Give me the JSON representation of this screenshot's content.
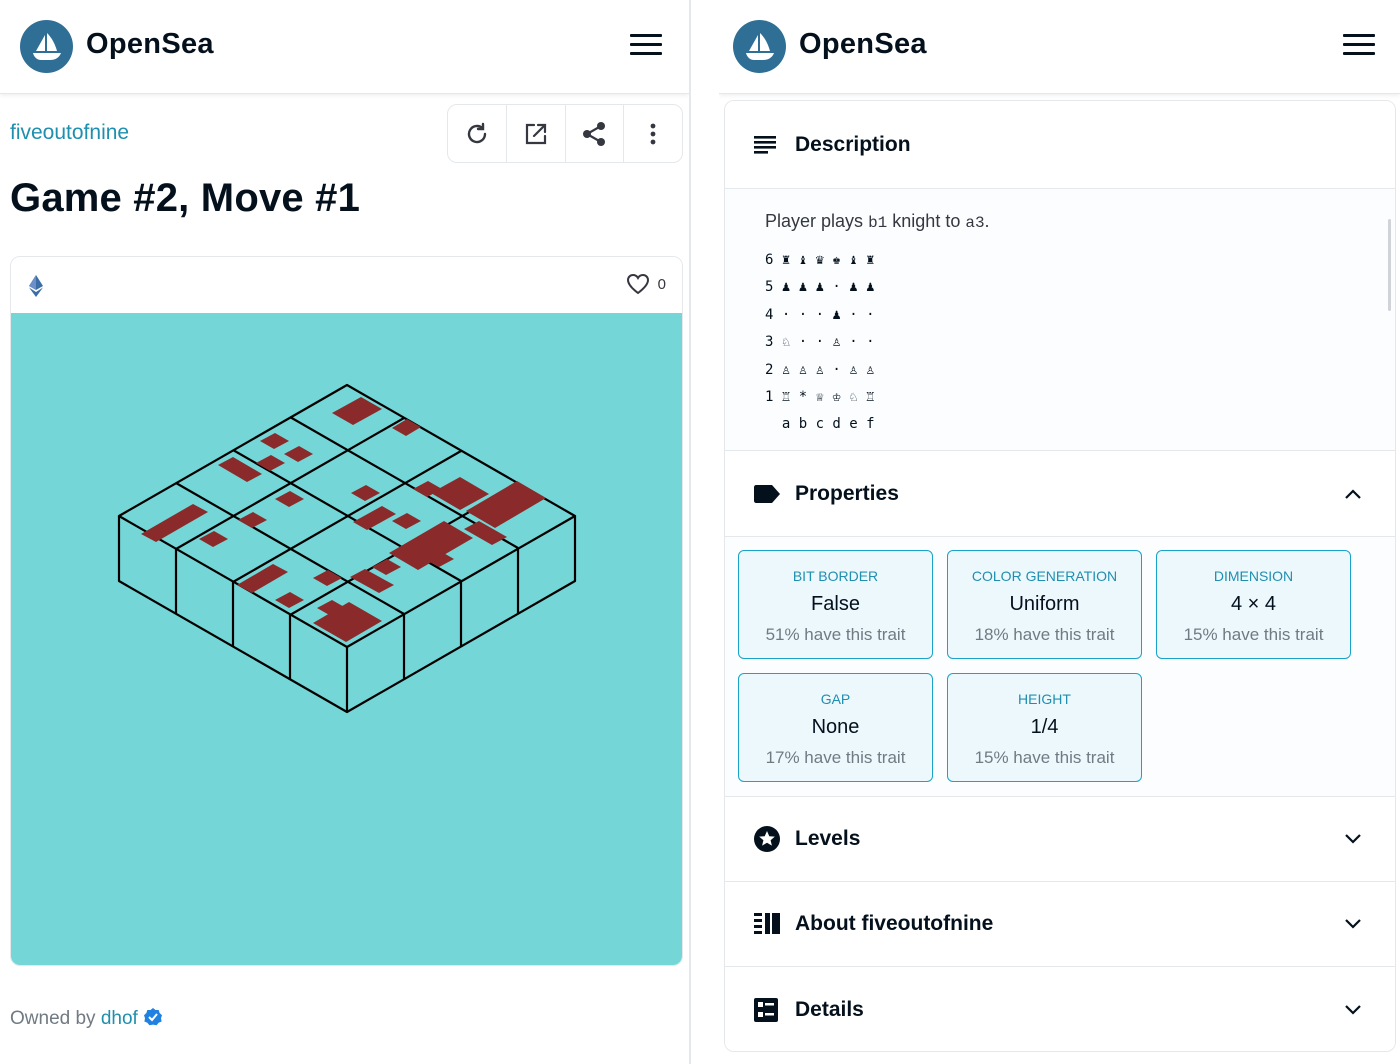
{
  "app": {
    "brand": "OpenSea"
  },
  "left": {
    "collection": "fiveoutofnine",
    "title": "Game #2, Move #1",
    "favorites": "0",
    "owned_prefix": "Owned by",
    "owner": "dhof"
  },
  "right": {
    "description": {
      "heading": "Description",
      "line_prefix": "Player plays",
      "from": "b1",
      "middle": "knight to",
      "to": "a3",
      "end": ".",
      "board": [
        "6 ♜ ♝ ♛ ♚ ♝ ♜",
        "5 ♟ ♟ ♟ · ♟ ♟",
        "4 · · · ♟ · ·",
        "3 ♘ · · ♙ · ·",
        "2 ♙ ♙ ♙ · ♙ ♙",
        "1 ♖ * ♕ ♔ ♘ ♖",
        "  a b c d e f"
      ]
    },
    "properties": {
      "heading": "Properties",
      "items": [
        {
          "type": "BIT BORDER",
          "value": "False",
          "rarity": "51% have this trait"
        },
        {
          "type": "COLOR GENERATION",
          "value": "Uniform",
          "rarity": "18% have this trait"
        },
        {
          "type": "DIMENSION",
          "value": "4 × 4",
          "rarity": "15% have this trait"
        },
        {
          "type": "GAP",
          "value": "None",
          "rarity": "17% have this trait"
        },
        {
          "type": "HEIGHT",
          "value": "1/4",
          "rarity": "15% have this trait"
        }
      ]
    },
    "levels": {
      "heading": "Levels"
    },
    "about": {
      "heading": "About fiveoutofnine"
    },
    "details": {
      "heading": "Details"
    }
  },
  "colors": {
    "accent": "#1f8fb0",
    "art_bg": "#74d6d6",
    "art_red": "#8b2a2a",
    "logo": "#2f6f95"
  },
  "icons": [
    "sailboat-logo-icon",
    "menu-icon",
    "refresh-icon",
    "external-link-icon",
    "share-icon",
    "more-vertical-icon",
    "ethereum-icon",
    "heart-icon",
    "verified-badge-icon",
    "description-lines-icon",
    "tag-icon",
    "chevron-up-icon",
    "star-icon",
    "chevron-down-icon",
    "about-columns-icon",
    "details-grid-icon"
  ]
}
